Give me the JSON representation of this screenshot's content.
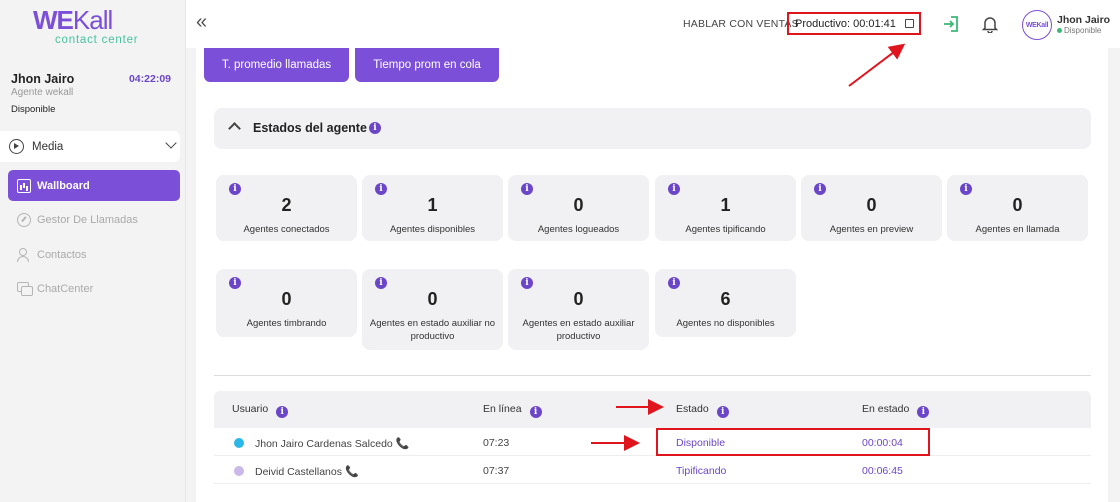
{
  "brand": {
    "logo_main_a": "WE",
    "logo_main_b": "Kall",
    "logo_sub": "contact center",
    "accent": "#7b4fd8",
    "green": "#46c39b"
  },
  "agent": {
    "name": "Jhon Jairo",
    "role": "Agente wekall",
    "status": "Disponible",
    "timer": "04:22:09"
  },
  "sidebar": {
    "media_label": "Media",
    "items": [
      {
        "label": "Wallboard",
        "active": true,
        "icon": "wallboard-icon"
      },
      {
        "label": "Gestor De Llamadas",
        "active": false,
        "icon": "gauge-icon"
      },
      {
        "label": "Contactos",
        "active": false,
        "icon": "add-user-icon"
      },
      {
        "label": "ChatCenter",
        "active": false,
        "icon": "chat-icon"
      }
    ]
  },
  "header": {
    "collapse_glyph": "«",
    "sales_link": "HABLAR CON VENTAS",
    "productive_label": "Productivo: 00:01:41",
    "avatar_text": "WEKall",
    "user_name": "Jhon Jairo",
    "user_status": "Disponible"
  },
  "tabs": [
    {
      "label": "T. promedio llamadas"
    },
    {
      "label": "Tiempo prom en cola"
    }
  ],
  "section": {
    "title": "Estados del agente"
  },
  "cards": [
    {
      "value": "2",
      "label": "Agentes conectados"
    },
    {
      "value": "1",
      "label": "Agentes disponibles"
    },
    {
      "value": "0",
      "label": "Agentes logueados"
    },
    {
      "value": "1",
      "label": "Agentes tipificando"
    },
    {
      "value": "0",
      "label": "Agentes en preview"
    },
    {
      "value": "0",
      "label": "Agentes en llamada"
    },
    {
      "value": "0",
      "label": "Agentes timbrando"
    },
    {
      "value": "0",
      "label": "Agentes en estado auxiliar no productivo"
    },
    {
      "value": "0",
      "label": "Agentes en estado auxiliar productivo"
    },
    {
      "value": "6",
      "label": "Agentes no disponibles"
    }
  ],
  "table": {
    "headers": [
      "Usuario",
      "En línea",
      "Estado",
      "En estado"
    ],
    "rows": [
      {
        "user": "Jhon Jairo Cardenas Salcedo",
        "online": "07:23",
        "state": "Disponible",
        "in_state": "00:00:04",
        "dot_color": "#2bb8e8",
        "state_color": "#6b46c8"
      },
      {
        "user": "Deivid Castellanos",
        "online": "07:37",
        "state": "Tipificando",
        "in_state": "00:06:45",
        "dot_color": "#c9b8e8",
        "state_color": "#6b46c8"
      }
    ]
  },
  "info_glyph": "i",
  "phone_glyph": "📞"
}
